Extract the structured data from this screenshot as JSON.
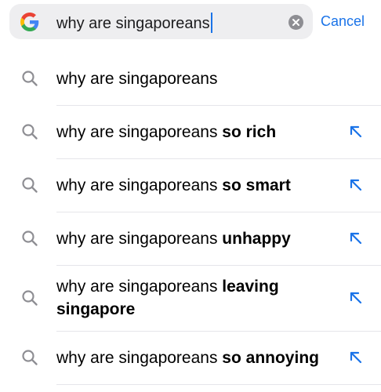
{
  "search": {
    "query": "why are singaporeans",
    "cancel_label": "Cancel"
  },
  "suggestions": [
    {
      "prefix": "why are singaporeans",
      "bold": "",
      "has_arrow": false
    },
    {
      "prefix": "why are singaporeans ",
      "bold": "so rich",
      "has_arrow": true
    },
    {
      "prefix": "why are singaporeans ",
      "bold": "so smart",
      "has_arrow": true
    },
    {
      "prefix": "why are singaporeans ",
      "bold": "unhappy",
      "has_arrow": true
    },
    {
      "prefix": "why are singaporeans ",
      "bold": "leaving singapore",
      "has_arrow": true
    },
    {
      "prefix": "why are singaporeans ",
      "bold": "so annoying",
      "has_arrow": true
    }
  ],
  "colors": {
    "accent": "#1a73e8",
    "icon_gray": "#8e8e93",
    "search_bg": "#eeeef0"
  },
  "icons": {
    "logo": "google-g-icon",
    "clear": "clear-x-icon",
    "search": "magnifier-icon",
    "fill": "arrow-up-left-icon"
  }
}
